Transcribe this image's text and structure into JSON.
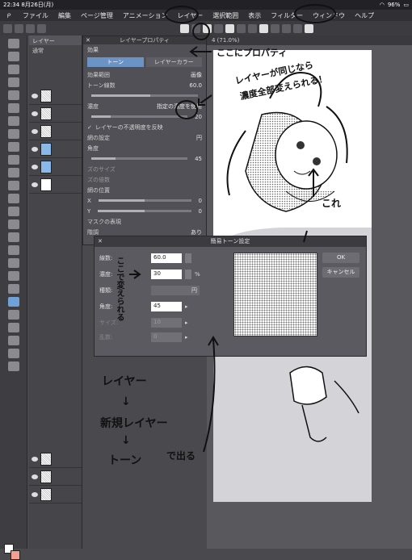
{
  "status": {
    "time": "22:34",
    "date": "8月26日(月)",
    "battery": "96%"
  },
  "menu": [
    "ファイル",
    "編集",
    "ページ管理",
    "アニメーション",
    "レイヤー",
    "選択範囲",
    "表示",
    "フィルター",
    "ウィンドウ",
    "ヘルプ"
  ],
  "layer_panel": {
    "tab": "レイヤー",
    "blend_mode": "通常"
  },
  "prop_window": {
    "title": "レイヤープロパティ",
    "section": "効果",
    "tab_tone": "トーン",
    "tab_color": "レイヤーカラー",
    "effect_range_label": "効果範囲",
    "effect_range_value": "画像",
    "lines_label": "トーン線数",
    "lines_value": "60.0",
    "density_label": "濃度",
    "density_mode": "指定の濃度を使用",
    "density_value": "20",
    "invert_label": "レイヤーの不透明度を反映",
    "dot_label": "網の設定",
    "dot_value": "円",
    "angle_label": "角度",
    "angle_value": "45",
    "dot_size_label": "ズのサイズ",
    "noise_label": "ズの倍数",
    "pos_label": "網の位置",
    "x_label": "X",
    "x_value": "0",
    "y_label": "Y",
    "y_value": "0",
    "mask_label": "マスクの表現",
    "mask_mode_label": "階調",
    "mask_mode_value": "あり"
  },
  "canvas_tab": "4 (71.0%)",
  "dialog": {
    "title": "簡易トーン設定",
    "lines_label": "線数:",
    "lines_value": "60.0",
    "density_label": "濃度:",
    "density_value": "30",
    "density_unit": "%",
    "type_label": "種類:",
    "type_value": "円",
    "angle_label": "角度:",
    "angle_value": "45",
    "size_label": "サイズ:",
    "size_value": "10",
    "noise_label": "乱数:",
    "noise_value": "0",
    "ok": "OK",
    "cancel": "キャンセル"
  },
  "annotations": {
    "top1": "ここにプロパティ",
    "top2a": "レイヤーが同じなら",
    "top2b": "濃度全部変えられる！",
    "kore": "これ",
    "side": "ここで変えられる",
    "steps": [
      "レイヤー",
      "↓",
      "新規レイヤー",
      "↓",
      "トーン",
      "で出る"
    ]
  }
}
